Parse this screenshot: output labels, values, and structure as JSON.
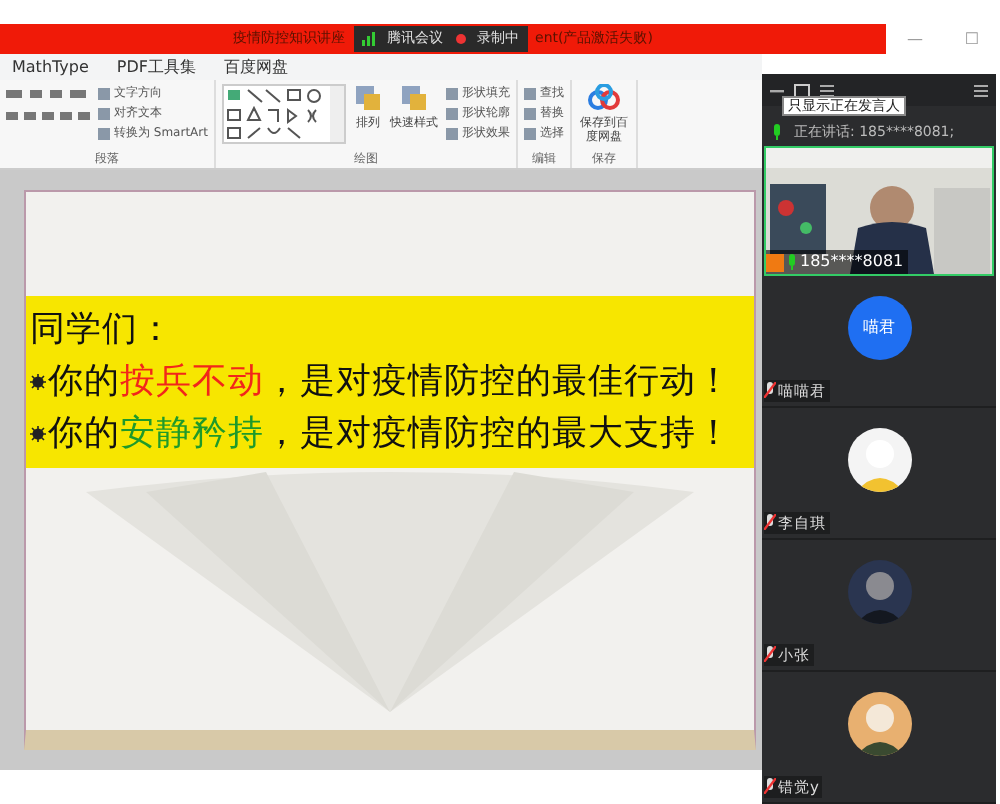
{
  "window": {
    "title": "疫情防控知识讲座",
    "title_suffix": "ent(产品激活失败)",
    "controls": [
      "—",
      "☐"
    ]
  },
  "meeting_badge": {
    "app": "腾讯会议",
    "recording": "录制中"
  },
  "menu": [
    "MathType",
    "PDF工具集",
    "百度网盘"
  ],
  "ribbon": {
    "groups": [
      {
        "kind": "paragraph",
        "label": "段落",
        "items": [
          "文字方向",
          "对齐文本",
          "转换为 SmartArt"
        ]
      },
      {
        "kind": "drawing",
        "label": "绘图",
        "big": [
          "排列",
          "快速样式"
        ],
        "items": [
          "形状填充",
          "形状轮廓",
          "形状效果"
        ]
      },
      {
        "kind": "edit",
        "label": "编辑",
        "items": [
          "查找",
          "替换",
          "选择"
        ]
      },
      {
        "kind": "save",
        "label": "保存",
        "big": [
          "保存到百度网盘"
        ]
      }
    ]
  },
  "slide": {
    "heading": "同学们：",
    "bullets": [
      [
        {
          "text": "你的"
        },
        {
          "text": "按兵不动",
          "color": "#f2261a"
        },
        {
          "text": "，是对疫情防控的最佳行动！"
        }
      ],
      [
        {
          "text": "你的"
        },
        {
          "text": "安静矜持",
          "color": "#1e9a2a"
        },
        {
          "text": "，是对疫情防控的最大支持！"
        }
      ]
    ]
  },
  "sidebar": {
    "tooltip": "只显示正在发言人",
    "speaking": "正在讲话: 185****8081;",
    "participants": [
      {
        "kind": "video",
        "name": "185****8081",
        "muted": false
      },
      {
        "kind": "initials",
        "initials": "喵君",
        "name": "喵喵君",
        "muted": true
      },
      {
        "name": "李自琪",
        "muted": true
      },
      {
        "name": "小张",
        "muted": true
      },
      {
        "name": "错觉y",
        "muted": true
      }
    ]
  }
}
